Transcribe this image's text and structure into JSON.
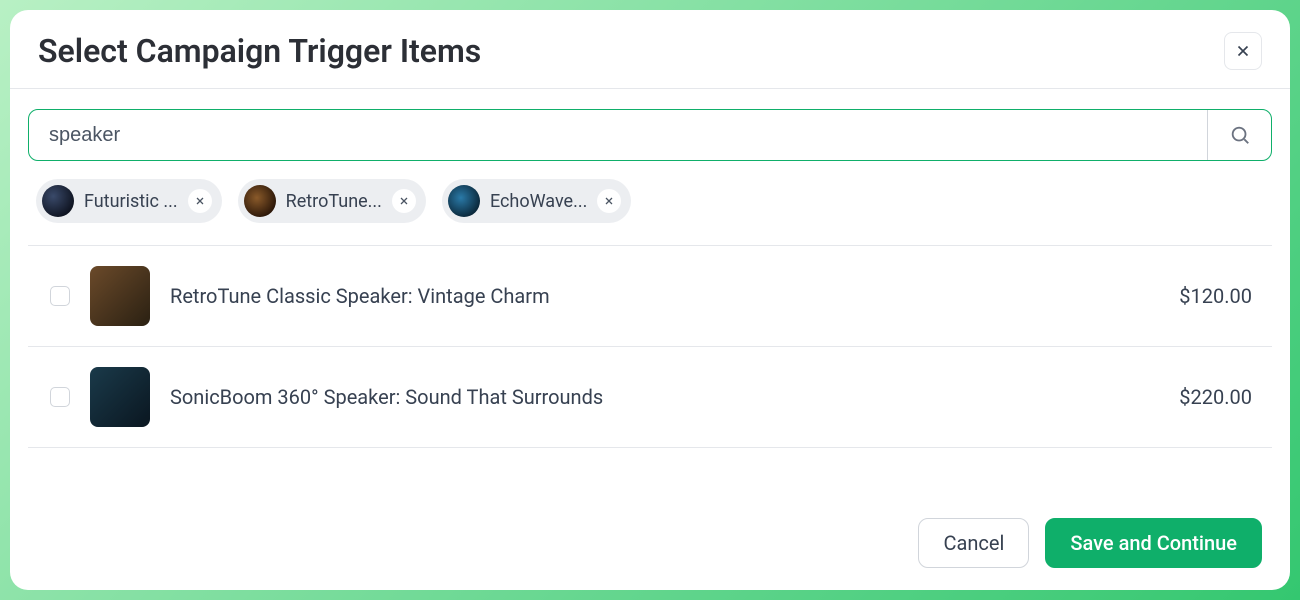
{
  "modal": {
    "title": "Select Campaign Trigger Items",
    "search_value": "speaker"
  },
  "chips": [
    {
      "label": "Futuristic ..."
    },
    {
      "label": "RetroTune..."
    },
    {
      "label": "EchoWave..."
    }
  ],
  "results": [
    {
      "name": "RetroTune Classic Speaker: Vintage Charm",
      "price": "$120.00"
    },
    {
      "name": "SonicBoom 360° Speaker: Sound That Surrounds",
      "price": "$220.00"
    }
  ],
  "footer": {
    "cancel": "Cancel",
    "save": "Save and Continue"
  }
}
